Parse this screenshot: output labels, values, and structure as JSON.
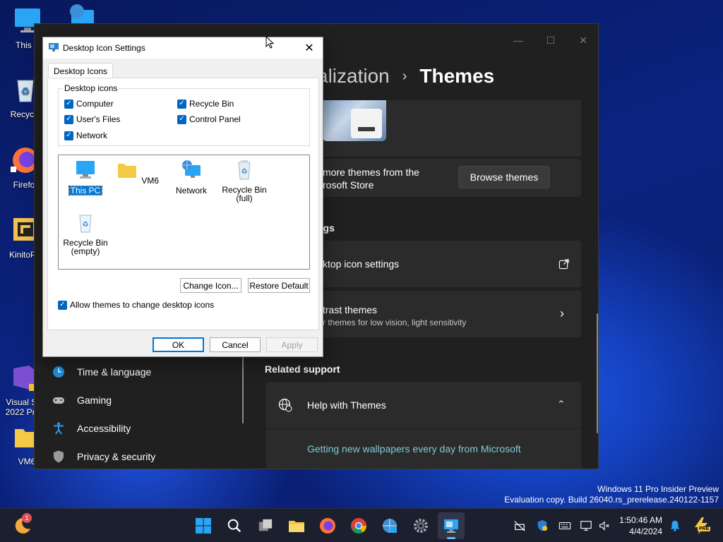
{
  "desktop": {
    "icons": [
      {
        "label": "This P"
      },
      {
        "label": "Recycle"
      },
      {
        "label": "Firefo"
      },
      {
        "label": "KinitoPE"
      },
      {
        "label": "Visual St\n2022 Pre"
      },
      {
        "label": "VM6"
      }
    ]
  },
  "settings": {
    "breadcrumb_parent": "alization",
    "breadcrumb_separator": "›",
    "breadcrumb_current": "Themes",
    "store_card": {
      "title": "more themes from the",
      "subtitle": "rosoft Store",
      "button": "Browse themes"
    },
    "related_settings_header": "ngs",
    "desktop_icon_settings": "ktop icon settings",
    "contrast_themes": {
      "title": "trast themes",
      "subtitle": "r themes for low vision, light sensitivity"
    },
    "related_support_header": "Related support",
    "help_card": {
      "title": "Help with Themes",
      "link": "Getting new wallpapers every day from Microsoft"
    },
    "nav": [
      {
        "label": "Time & language",
        "icon": "globe-clock-icon"
      },
      {
        "label": "Gaming",
        "icon": "gamepad-icon"
      },
      {
        "label": "Accessibility",
        "icon": "accessibility-icon"
      },
      {
        "label": "Privacy & security",
        "icon": "shield-icon"
      }
    ]
  },
  "dialog": {
    "title": "Desktop Icon Settings",
    "tab": "Desktop Icons",
    "group_label": "Desktop icons",
    "checkboxes": [
      {
        "label": "Computer",
        "checked": true
      },
      {
        "label": "User's Files",
        "checked": true
      },
      {
        "label": "Network",
        "checked": true
      },
      {
        "label": "Recycle Bin",
        "checked": true
      },
      {
        "label": "Control Panel",
        "checked": true
      }
    ],
    "icon_items": [
      {
        "label": "This PC",
        "selected": true
      },
      {
        "label": "VM6",
        "selected": false
      },
      {
        "label": "Network",
        "selected": false
      },
      {
        "label": "Recycle Bin (full)",
        "selected": false
      },
      {
        "label": "Recycle Bin (empty)",
        "selected": false
      }
    ],
    "change_icon": "Change Icon...",
    "restore_default": "Restore Default",
    "allow_themes": "Allow themes to change desktop icons",
    "ok": "OK",
    "cancel": "Cancel",
    "apply": "Apply"
  },
  "watermark": {
    "line1": "Windows 11 Pro Insider Preview",
    "line2": "Evaluation copy. Build 26040.rs_prerelease.240122-1157"
  },
  "taskbar": {
    "badge_count": "1",
    "time": "1:50:46 AM",
    "date": "4/4/2024",
    "tray_badge": "PRE"
  }
}
